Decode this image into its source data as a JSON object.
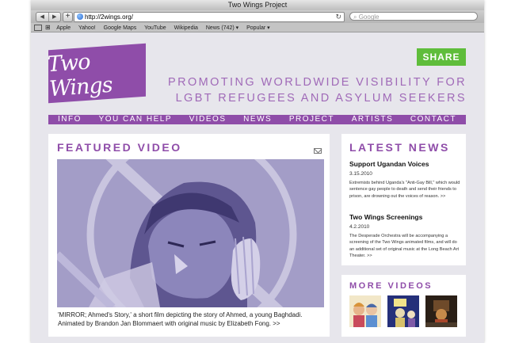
{
  "window": {
    "title": "Two Wings Project"
  },
  "toolbar": {
    "back_icon": "back-arrow-icon",
    "forward_icon": "forward-arrow-icon",
    "url": "http://2wings.org/",
    "search_placeholder": "Google"
  },
  "bookmarks": [
    "Apple",
    "Yahoo!",
    "Google Maps",
    "YouTube",
    "Wikipedia",
    "News (742) ▾",
    "Popular ▾"
  ],
  "site": {
    "logo_text": "Two Wings",
    "share_label": "SHARE",
    "tagline_line1": "PROMOTING WORLDWIDE VISIBILITY FOR",
    "tagline_line2": "LGBT REFUGEES AND ASYLUM SEEKERS",
    "colors": {
      "purple": "#8f4da9",
      "green": "#5fbd3b"
    }
  },
  "nav": [
    "INFO",
    "YOU CAN HELP",
    "VIDEOS",
    "NEWS",
    "PROJECT",
    "ARTISTS",
    "CONTACT"
  ],
  "featured": {
    "title": "FEATURED VIDEO",
    "caption_line1": "'MIRROR; Ahmed's Story,'  a short film depicting the story of Ahmed, a young Baghdadi.",
    "caption_line2": "Animated by Brandon Jan Blommaert with original music by Elizabeth Fong. >>"
  },
  "news": {
    "title": "LATEST NEWS",
    "items": [
      {
        "headline": "Support Ugandan Voices",
        "date": "3.15.2010",
        "body": "Extremists behind Uganda's \"Anti-Gay Bill,\" which would sentence gay people to death and send their friends to prison, are drowning out the voices of reason. >>"
      },
      {
        "headline": "Two Wings Screenings",
        "date": "4.2.2010",
        "body": "The Desperade Orchestra will be accompanying a screening of the Two Wings animated films, and will do an additional set of original music at the Long Beach Art Theater. >>"
      }
    ]
  },
  "more_videos": {
    "title": "MORE VIDEOS"
  }
}
